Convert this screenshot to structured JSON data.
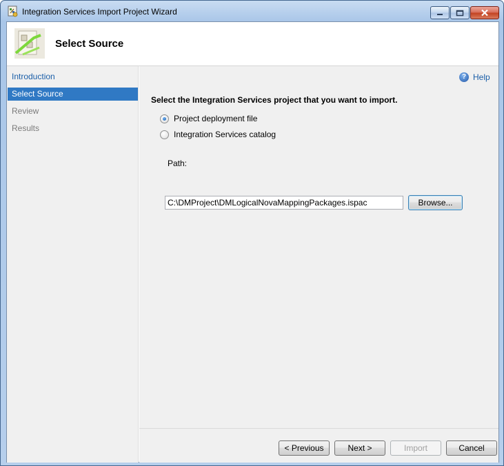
{
  "window": {
    "title": "Integration Services Import Project Wizard"
  },
  "header": {
    "title": "Select Source"
  },
  "nav": {
    "items": [
      {
        "label": "Introduction",
        "state": "link"
      },
      {
        "label": "Select Source",
        "state": "active"
      },
      {
        "label": "Review",
        "state": "disabled"
      },
      {
        "label": "Results",
        "state": "disabled"
      }
    ]
  },
  "help": {
    "label": "Help",
    "icon": "help-icon"
  },
  "main": {
    "instruction": "Select the Integration Services project that you want to import.",
    "options": [
      {
        "label": "Project deployment file",
        "checked": true
      },
      {
        "label": "Integration Services catalog",
        "checked": false
      }
    ],
    "path_label": "Path:",
    "path_value": "C:\\DMProject\\DMLogicalNovaMappingPackages.ispac",
    "browse_label": "Browse..."
  },
  "footer": {
    "previous_label": "< Previous",
    "next_label": "Next >",
    "import_label": "Import",
    "cancel_label": "Cancel"
  },
  "colors": {
    "accent": "#3079c4",
    "link": "#1a5ea8",
    "panel": "#f0f0f0"
  }
}
